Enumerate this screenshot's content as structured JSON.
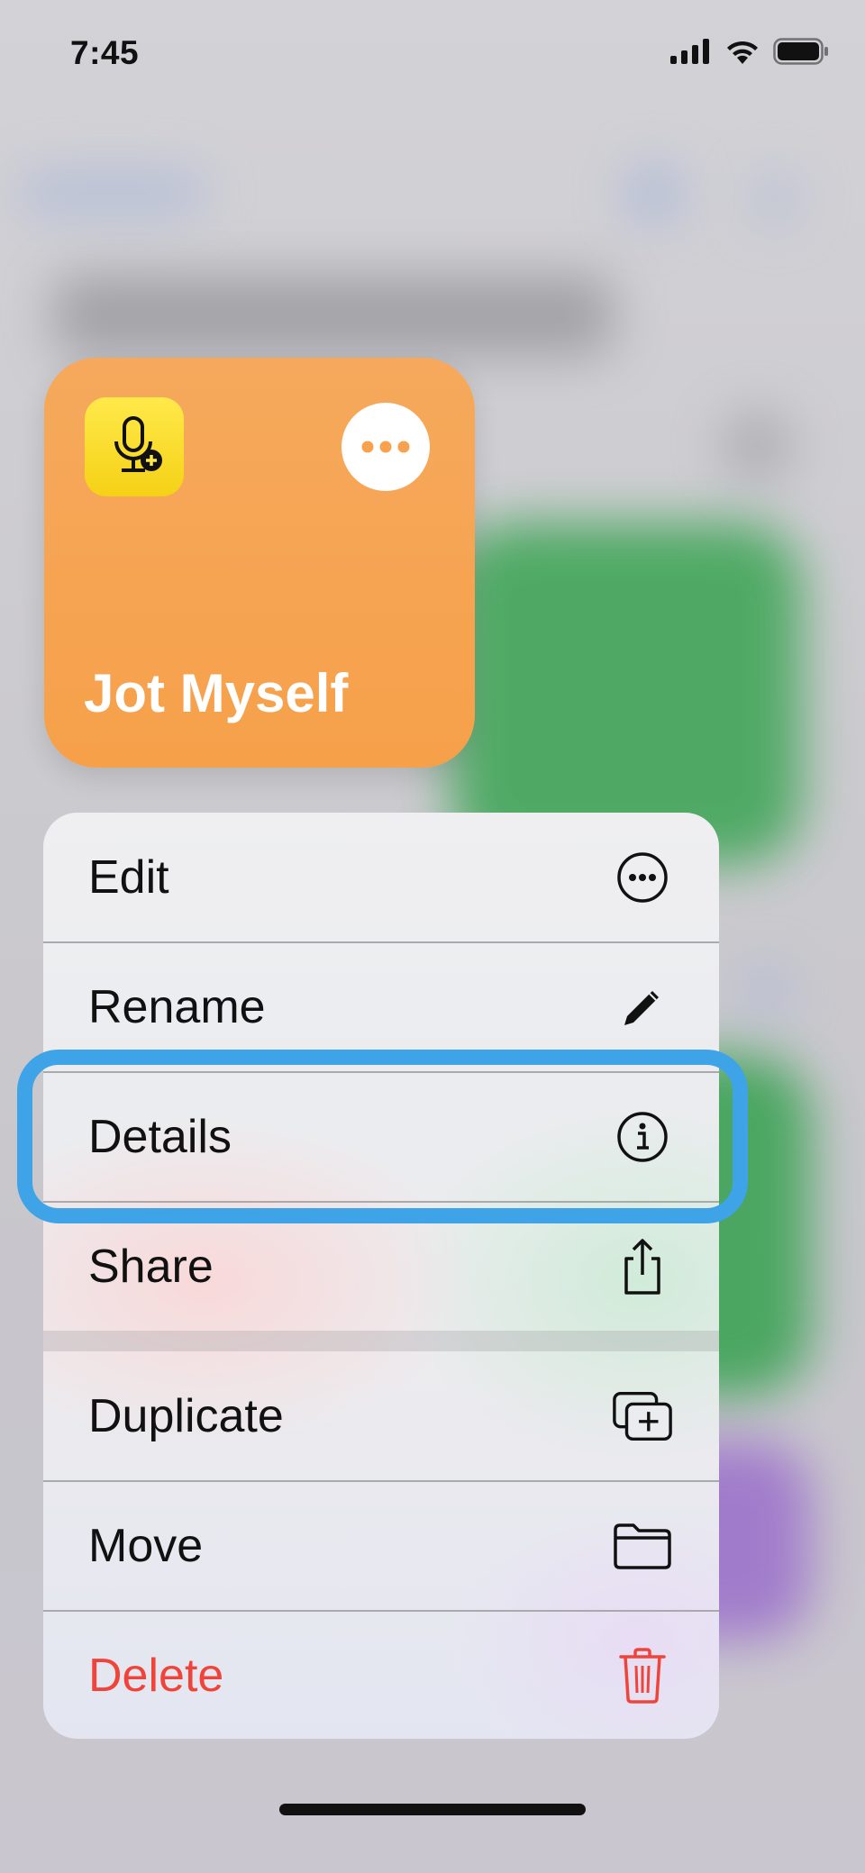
{
  "status_bar": {
    "time": "7:45"
  },
  "shortcut_card": {
    "title": "Jot Myself",
    "icon": "microphone-plus-icon",
    "background_color": "#F6A24E"
  },
  "context_menu": {
    "items": [
      {
        "label": "Edit",
        "icon": "ellipsis-circle-icon"
      },
      {
        "label": "Rename",
        "icon": "pencil-icon"
      },
      {
        "label": "Details",
        "icon": "info-circle-icon"
      },
      {
        "label": "Share",
        "icon": "share-icon"
      },
      {
        "label": "Duplicate",
        "icon": "duplicate-plus-icon"
      },
      {
        "label": "Move",
        "icon": "folder-icon"
      },
      {
        "label": "Delete",
        "icon": "trash-icon",
        "destructive_color": "#F0443A"
      }
    ],
    "highlighted_item": "Details",
    "highlight_color": "#3EA3E7"
  }
}
